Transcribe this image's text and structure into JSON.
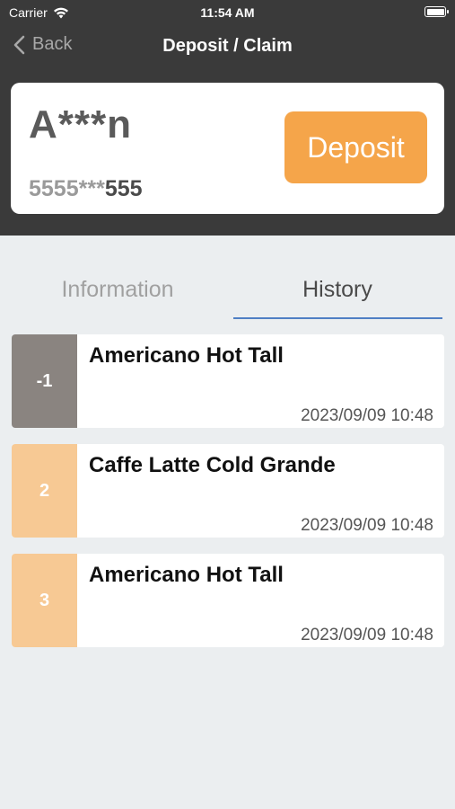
{
  "status_bar": {
    "carrier": "Carrier",
    "time": "11:54 AM"
  },
  "nav": {
    "back_label": "Back",
    "title": "Deposit / Claim"
  },
  "card": {
    "name": "A***n",
    "number_masked": "5555***",
    "number_suffix": "555",
    "deposit_label": "Deposit"
  },
  "tabs": [
    {
      "label": "Information",
      "active": false
    },
    {
      "label": "History",
      "active": true
    }
  ],
  "history": [
    {
      "qty": "-1",
      "title": "Americano Hot Tall",
      "datetime": "2023/09/09 10:48",
      "color": "#8a8480"
    },
    {
      "qty": "2",
      "title": "Caffe Latte Cold Grande",
      "datetime": "2023/09/09 10:48",
      "color": "#f7c994"
    },
    {
      "qty": "3",
      "title": "Americano Hot Tall",
      "datetime": "2023/09/09 10:48",
      "color": "#f7c994"
    }
  ],
  "colors": {
    "header_bg": "#3a3a3a",
    "accent_orange": "#f5a54a",
    "tab_underline": "#4f7fc4",
    "page_bg": "#ebeef0"
  }
}
